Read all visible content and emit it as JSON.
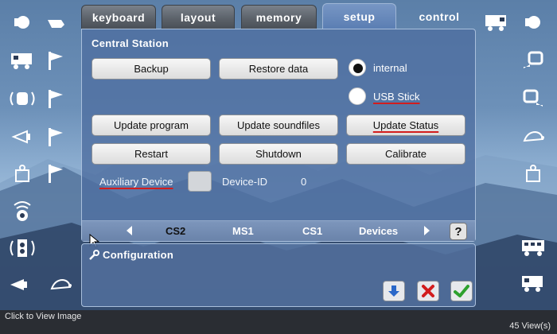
{
  "tabs": [
    {
      "label": "keyboard",
      "active": false
    },
    {
      "label": "layout",
      "active": false
    },
    {
      "label": "memory",
      "active": false
    },
    {
      "label": "setup",
      "active": true
    },
    {
      "label": "control",
      "active": false
    }
  ],
  "panel": {
    "title": "Central Station",
    "buttons": {
      "backup": "Backup",
      "restore": "Restore data",
      "update_program": "Update program",
      "update_soundfiles": "Update soundfiles",
      "update_status": "Update Status",
      "restart": "Restart",
      "shutdown": "Shutdown",
      "calibrate": "Calibrate"
    },
    "storage": {
      "internal": "internal",
      "usb": "USB Stick",
      "selected": "internal"
    },
    "aux_label": "Auxiliary Device",
    "device_id_label": "Device-ID",
    "device_id_value": "0"
  },
  "devbar": {
    "items": [
      "CS2",
      "MS1",
      "CS1",
      "Devices"
    ],
    "selected": "CS2",
    "help": "?"
  },
  "config": {
    "title": "Configuration"
  },
  "footer": {
    "left": "Click to View Image",
    "right": "45 View(s)"
  },
  "colors": {
    "accent": "#5b7eb3",
    "ok": "#2ea12e",
    "cancel": "#d21d1d",
    "down": "#2a68c9"
  }
}
